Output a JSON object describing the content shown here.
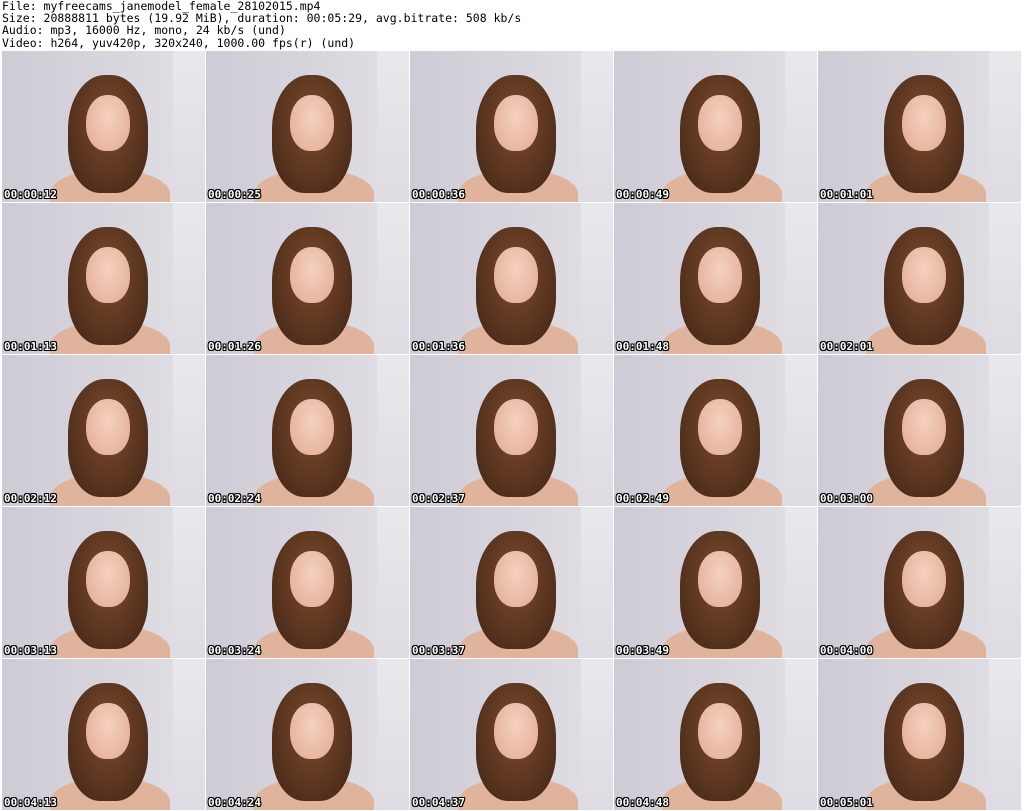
{
  "header": {
    "file": "File: myfreecams_janemodel_female_28102015.mp4",
    "size": "Size: 20888811 bytes (19.92 MiB), duration: 00:05:29, avg.bitrate: 508 kb/s",
    "audio": "Audio: mp3, 16000 Hz, mono, 24 kb/s (und)",
    "video": "Video: h264, yuv420p, 320x240, 1000.00 fps(r) (und)"
  },
  "thumbnails": [
    "00:00:12",
    "00:00:25",
    "00:00:36",
    "00:00:49",
    "00:01:01",
    "00:01:13",
    "00:01:26",
    "00:01:36",
    "00:01:48",
    "00:02:01",
    "00:02:12",
    "00:02:24",
    "00:02:37",
    "00:02:49",
    "00:03:00",
    "00:03:13",
    "00:03:24",
    "00:03:37",
    "00:03:49",
    "00:04:00",
    "00:04:13",
    "00:04:24",
    "00:04:37",
    "00:04:48",
    "00:05:01"
  ]
}
